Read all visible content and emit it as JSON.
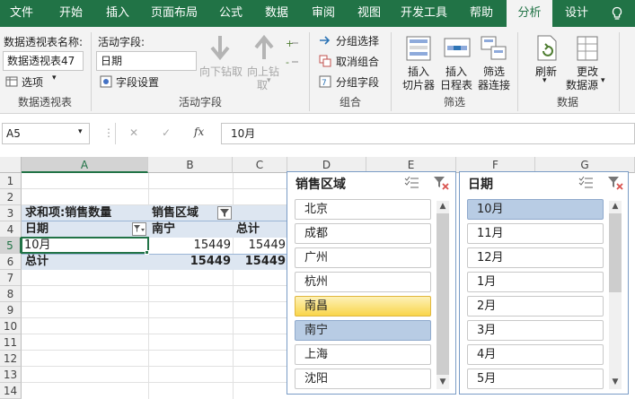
{
  "tabs": [
    "文件",
    "开始",
    "插入",
    "页面布局",
    "公式",
    "数据",
    "审阅",
    "视图",
    "开发工具",
    "帮助",
    "分析",
    "设计"
  ],
  "active_tab": "分析",
  "ribbon": {
    "pivot_name_label": "数据透视表名称:",
    "pivot_name_value": "数据透视表47",
    "options_label": "选项",
    "group_pivot": "数据透视表",
    "active_field_label": "活动字段:",
    "active_field_value": "日期",
    "field_settings_label": "字段设置",
    "drill_down_label": "向下钻取",
    "drill_up_label": "向上钻",
    "drill_up_label2": "取",
    "group_active_field": "活动字段",
    "group_selection": "分组选择",
    "ungroup": "取消组合",
    "group_field": "分组字段",
    "group_group": "组合",
    "insert_slicer_1": "插入",
    "insert_slicer_2": "切片器",
    "insert_timeline_1": "插入",
    "insert_timeline_2": "日程表",
    "filter_conn_1": "筛选",
    "filter_conn_2": "器连接",
    "group_filter": "筛选",
    "refresh_label": "刷新",
    "change_source_1": "更改",
    "change_source_2": "数据源",
    "group_data": "数据"
  },
  "formula_bar": {
    "name_box": "A5",
    "cancel_symbol": "✕",
    "enter_symbol": "✓",
    "fx_label": "fx",
    "formula": "10月"
  },
  "grid": {
    "columns": [
      "A",
      "B",
      "C",
      "D",
      "E",
      "F",
      "G"
    ],
    "rows": [
      "1",
      "2",
      "3",
      "4",
      "5",
      "6",
      "7",
      "8",
      "9",
      "10",
      "11",
      "12",
      "13",
      "14"
    ],
    "selected_column": "A",
    "selected_row": "5",
    "pivot": {
      "sum_label": "求和项:销售数量",
      "col_field": "销售区域",
      "row_field": "日期",
      "col_item": "南宁",
      "total_header": "总计",
      "row_item": "10月",
      "row_value": "15449",
      "row_total": "15449",
      "grand_total_label": "总计",
      "grand_value": "15449",
      "grand_total": "15449"
    }
  },
  "slicers": {
    "region": {
      "title": "销售区域",
      "items": [
        "北京",
        "成都",
        "广州",
        "杭州",
        "南昌",
        "南宁",
        "上海",
        "沈阳"
      ],
      "selected": "南宁",
      "hovered": "南昌"
    },
    "date": {
      "title": "日期",
      "items": [
        "10月",
        "11月",
        "12月",
        "1月",
        "2月",
        "3月",
        "4月",
        "5月"
      ],
      "selected": "10月"
    }
  },
  "colors": {
    "brand": "#217346",
    "pivot_header_bg": "#dde6f1",
    "slicer_selected": "#b8cce4",
    "slicer_hover": "#f9d54a"
  }
}
